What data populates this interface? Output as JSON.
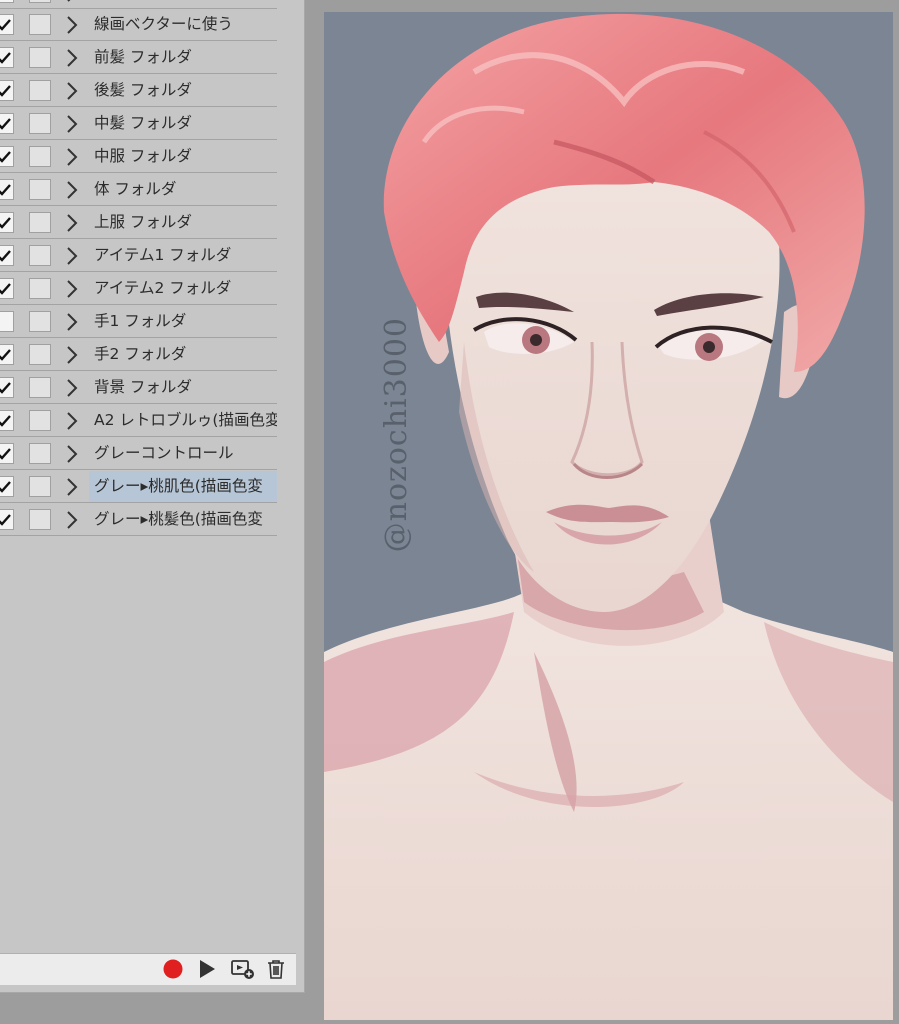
{
  "layers": [
    {
      "name": "線画ベクターに使う",
      "visible": true,
      "selected": false
    },
    {
      "name": "前髪 フォルダ",
      "visible": true,
      "selected": false
    },
    {
      "name": "後髪 フォルダ",
      "visible": true,
      "selected": false
    },
    {
      "name": "中髪 フォルダ",
      "visible": true,
      "selected": false
    },
    {
      "name": "中服 フォルダ",
      "visible": true,
      "selected": false
    },
    {
      "name": "体 フォルダ",
      "visible": true,
      "selected": false
    },
    {
      "name": "上服 フォルダ",
      "visible": true,
      "selected": false
    },
    {
      "name": "アイテム1 フォルダ",
      "visible": true,
      "selected": false
    },
    {
      "name": "アイテム2 フォルダ",
      "visible": true,
      "selected": false
    },
    {
      "name": "手1 フォルダ",
      "visible": false,
      "selected": false
    },
    {
      "name": "手2 フォルダ",
      "visible": true,
      "selected": false
    },
    {
      "name": "背景 フォルダ",
      "visible": true,
      "selected": false
    },
    {
      "name": "A2 レトロブルゥ(描画色変",
      "visible": true,
      "selected": false
    },
    {
      "name": "グレーコントロール",
      "visible": true,
      "selected": false
    },
    {
      "name": "グレー▸桃肌色(描画色変",
      "visible": true,
      "selected": true
    },
    {
      "name": "グレー▸桃髪色(描画色変",
      "visible": true,
      "selected": false
    }
  ],
  "bottom_bar": {
    "icons": [
      "record-icon",
      "play-icon",
      "add-action-icon",
      "trash-icon"
    ],
    "record_color": "#e02020"
  },
  "canvas": {
    "watermark": "@nozochi3000",
    "background_color": "#7b8593",
    "hair_color": "#e8868a",
    "skin_color": "#f1e3dd"
  }
}
